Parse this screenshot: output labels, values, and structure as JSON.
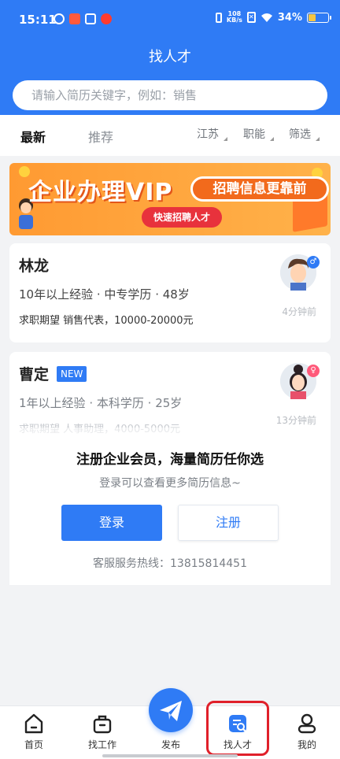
{
  "status_bar": {
    "time": "15:11",
    "net_speed_value": "108",
    "net_speed_unit": "KB/s",
    "battery": "34%"
  },
  "header": {
    "title": "找人才",
    "search_placeholder": "请输入简历关键字，例如：销售"
  },
  "tabs": [
    {
      "label": "最新",
      "active": true
    },
    {
      "label": "推荐",
      "active": false
    }
  ],
  "filters": [
    "江苏",
    "职能",
    "筛选"
  ],
  "banner": {
    "title": "企业办理VIP",
    "tagline": "招聘信息更靠前",
    "button": "快速招聘人才"
  },
  "resumes": [
    {
      "name": "林龙",
      "experience": "10年以上经验",
      "education": "中专学历",
      "age": "48岁",
      "expectation": "求职期望 销售代表，10000-20000元",
      "posted": "4分钟前",
      "gender_icon": "male-icon"
    },
    {
      "name": "曹定",
      "badge": "NEW",
      "experience": "1年以上经验",
      "education": "本科学历",
      "age": "25岁",
      "expectation": "求职期望 人事助理，4000-5000元",
      "posted": "13分钟前",
      "gender_icon": "female-icon"
    }
  ],
  "register_prompt": {
    "title": "注册企业会员，海量简历任你选",
    "subtitle": "登录可以查看更多简历信息~",
    "login_label": "登录",
    "register_label": "注册",
    "hotline": "客服服务热线：13815814451"
  },
  "bottom_nav": [
    {
      "label": "首页",
      "icon": "home-icon"
    },
    {
      "label": "找工作",
      "icon": "briefcase-icon"
    },
    {
      "label": "发布",
      "icon": "paper-plane-icon"
    },
    {
      "label": "找人才",
      "icon": "find-talent-icon",
      "active": true
    },
    {
      "label": "我的",
      "icon": "user-icon"
    }
  ],
  "colors": {
    "primary": "#2f7bf5",
    "highlight_box": "#e0202a"
  }
}
